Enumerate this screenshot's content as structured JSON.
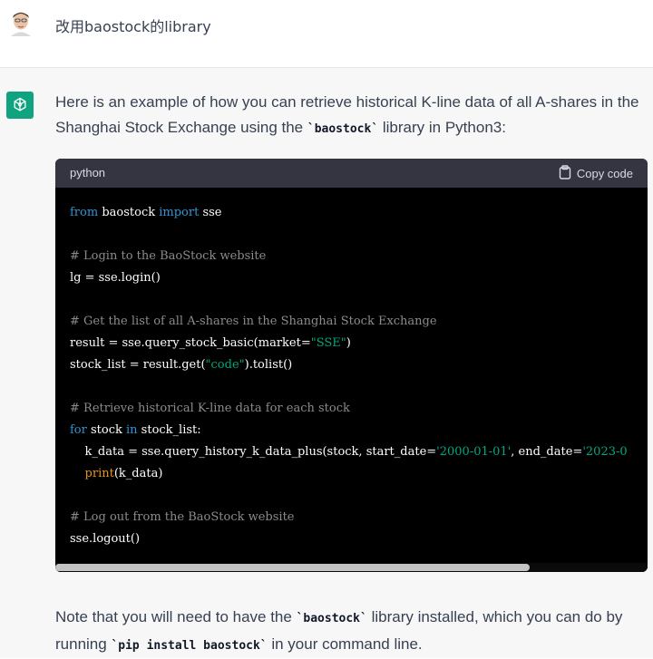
{
  "user": {
    "message": "改用baostock的library"
  },
  "assistant": {
    "intro_before": "Here is an example of how you can retrieve historical K-line data of all A-shares in the Shanghai Stock Exchange using the ",
    "intro_code": "`baostock`",
    "intro_after": " library in Python3:",
    "code_block": {
      "language": "python",
      "copy_label": "Copy code"
    },
    "code_lines": {
      "l1_kw1": "from",
      "l1_mod": " baostock ",
      "l1_kw2": "import",
      "l1_rest": " sse",
      "l3": "# Login to the BaoStock website",
      "l4": "lg = sse.login()",
      "l6": "# Get the list of all A-shares in the Shanghai Stock Exchange",
      "l7_a": "result = sse.query_stock_basic(market=",
      "l7_s": "\"SSE\"",
      "l7_b": ")",
      "l8_a": "stock_list = result.get(",
      "l8_s": "\"code\"",
      "l8_b": ").tolist()",
      "l10": "# Retrieve historical K-line data for each stock",
      "l11_kw": "for",
      "l11_a": " stock ",
      "l11_kw2": "in",
      "l11_b": " stock_list:",
      "l12_a": "    k_data = sse.query_history_k_data_plus(stock, start_date=",
      "l12_s": "'2000-01-01'",
      "l12_b": ", end_date=",
      "l12_s2": "'2023-0",
      "l13_fn": "    print",
      "l13_b": "(k_data)",
      "l15": "# Log out from the BaoStock website",
      "l16": "sse.logout()"
    },
    "note_before": "Note that you will need to have the ",
    "note_code1": "`baostock`",
    "note_mid": " library installed, which you can do by running ",
    "note_code2": "`pip install baostock`",
    "note_after": " in your command line."
  }
}
